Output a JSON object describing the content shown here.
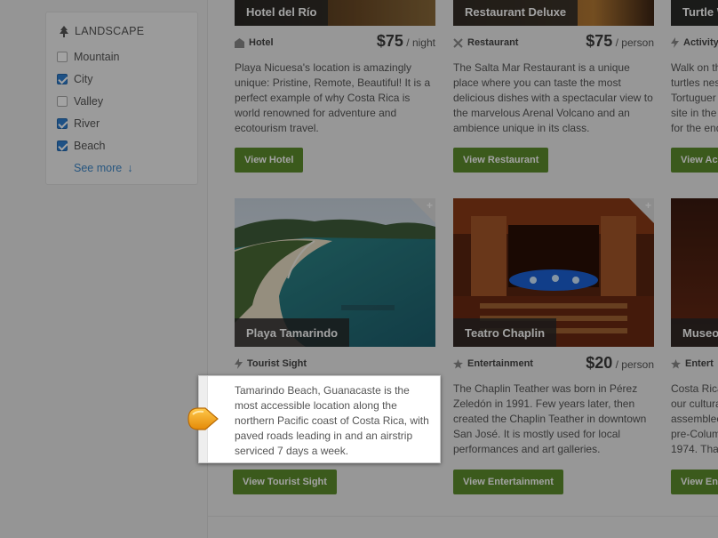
{
  "sidebar": {
    "title": "LANDSCAPE",
    "title_icon": "tree-icon",
    "filters": [
      {
        "label": "Mountain",
        "checked": false
      },
      {
        "label": "City",
        "checked": true
      },
      {
        "label": "Valley",
        "checked": false
      },
      {
        "label": "River",
        "checked": true
      },
      {
        "label": "Beach",
        "checked": true
      }
    ],
    "see_more": "See more",
    "see_more_arrow": "↓"
  },
  "cards": {
    "hotel": {
      "name": "Hotel del Río",
      "category": "Hotel",
      "category_icon": "building-icon",
      "price": "$75",
      "unit": "/ night",
      "description": "Playa Nicuesa's location is amazingly unique: Pristine, Remote, Beautiful! It is a perfect example of why Costa Rica is world renowned for adventure and ecotourism travel.",
      "button": "View Hotel"
    },
    "restaurant": {
      "name": "Restaurant Deluxe",
      "category": "Restaurant",
      "category_icon": "utensils-icon",
      "price": "$75",
      "unit": "/ person",
      "description": "The Salta Mar Restaurant is a unique place where you can taste the most delicious dishes with a spectacular view to the marvelous Arenal Volcano and an ambience unique in its class.",
      "button": "View Restaurant"
    },
    "activity": {
      "name": "Turtle W",
      "category": "Activity",
      "category_icon": "bolt-icon",
      "description_lines": [
        "Walk on th",
        "turtles nes",
        "Tortuguer",
        "site in the",
        "for the end"
      ],
      "button": "View Ac"
    },
    "tamarindo": {
      "name": "Playa Tamarindo",
      "category": "Tourist Sight",
      "category_icon": "bolt-icon",
      "description": "Tamarindo Beach, Guanacaste is the most accessible location along the northern Pacific coast of Costa Rica, with paved roads leading in and an airstrip serviced 7 days a week.",
      "button": "View Tourist Sight",
      "corner": "+"
    },
    "teatro": {
      "name": "Teatro Chaplin",
      "category": "Entertainment",
      "category_icon": "star-icon",
      "price": "$20",
      "unit": "/ person",
      "description": "The Chaplin Teather was born in Pérez Zeledón in 1991. Few years later, then created the Chaplin Teather in downtown San José. It is mostly used for local performances and art galleries.",
      "button": "View Entertainment",
      "corner": "+"
    },
    "museo": {
      "name": "Museo",
      "category": "Entert",
      "category_icon": "star-icon",
      "description_lines": [
        "Costa Rica",
        "our cultura",
        "assemblec",
        "pre-Colum",
        "1974.  Tha"
      ],
      "button": "View En"
    }
  },
  "colors": {
    "button_green": "#5d8d2d",
    "link_blue": "#3f88c9",
    "checkbox_blue": "#2f7fd0",
    "pointer_orange": "#f3a515"
  }
}
